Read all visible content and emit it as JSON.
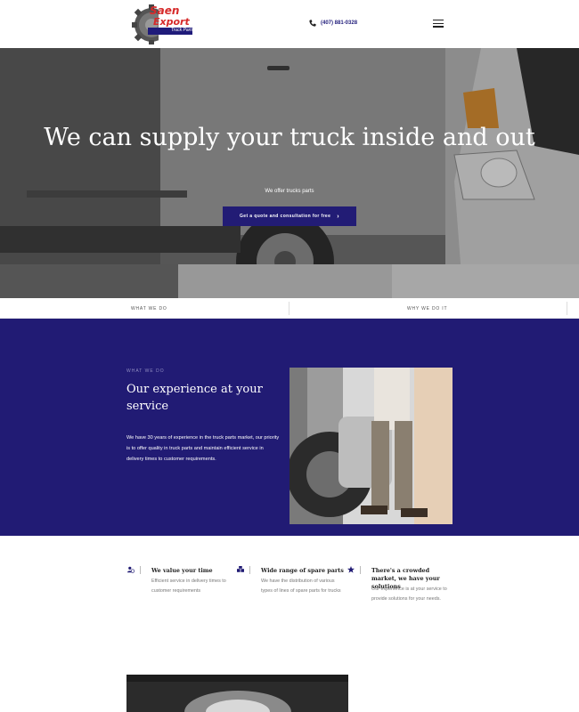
{
  "header": {
    "logo_line1": "Saen",
    "logo_line2": "Export",
    "logo_sub": "Truck Parts",
    "phone": "(407) 881-0328",
    "phone_icon": "phone-icon",
    "menu_icon": "hamburger-menu-icon"
  },
  "hero": {
    "title": "We can supply your truck inside and out",
    "subtitle": "We offer trucks parts",
    "cta_label": "Get a quote and consultation for free",
    "cta_icon": "›"
  },
  "tabs": [
    {
      "label": "WHAT WE DO"
    },
    {
      "label": "WHY WE DO IT"
    }
  ],
  "about": {
    "kicker": "WHAT WE DO",
    "heading": "Our experience at your service",
    "body": "We have 30 years of experience in the truck parts market, our priority is to offer quality in truck parts and maintain efficient service in delivery times to customer requirements."
  },
  "features": [
    {
      "icon": "user-clock-icon",
      "title": "We value your time",
      "desc": "Efficient service in delivery times to customer requirements"
    },
    {
      "icon": "boxes-icon",
      "title": "Wide range of spare parts",
      "desc": "We have the distribution of various types of lines of spare parts for trucks"
    },
    {
      "icon": "star-icon",
      "title": "There's a crowded market, we have your solutions",
      "desc": "Our experience is at your service to provide solutions for your needs."
    }
  ],
  "colors": {
    "brand_navy": "#211b74",
    "accent_red": "#d62a2a"
  }
}
